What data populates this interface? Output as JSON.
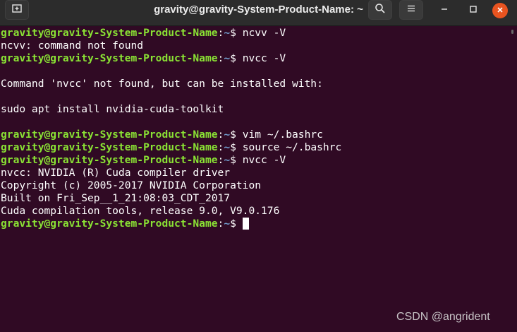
{
  "window": {
    "title": "gravity@gravity-System-Product-Name: ~"
  },
  "icons": {
    "new_tab": "new-tab-icon",
    "search": "search-icon",
    "menu": "hamburger-menu-icon",
    "minimize": "minimize-icon",
    "maximize": "maximize-icon",
    "close": "close-icon"
  },
  "colors": {
    "terminal_bg": "#300a24",
    "prompt_user": "#8ae234",
    "prompt_path": "#729fcf",
    "close_button": "#e95420"
  },
  "terminal": {
    "prompt_user": "gravity@gravity-System-Product-Name",
    "prompt_colon": ":",
    "prompt_path": "~",
    "prompt_symbol": "$ ",
    "lines": [
      {
        "type": "prompt",
        "command": "ncvv -V"
      },
      {
        "type": "output",
        "text": "ncvv: command not found"
      },
      {
        "type": "prompt",
        "command": "nvcc -V"
      },
      {
        "type": "output",
        "text": ""
      },
      {
        "type": "output",
        "text": "Command 'nvcc' not found, but can be installed with:"
      },
      {
        "type": "output",
        "text": ""
      },
      {
        "type": "output",
        "text": "sudo apt install nvidia-cuda-toolkit"
      },
      {
        "type": "output",
        "text": ""
      },
      {
        "type": "prompt",
        "command": "vim ~/.bashrc"
      },
      {
        "type": "prompt",
        "command": "source ~/.bashrc"
      },
      {
        "type": "prompt",
        "command": "nvcc -V"
      },
      {
        "type": "output",
        "text": "nvcc: NVIDIA (R) Cuda compiler driver"
      },
      {
        "type": "output",
        "text": "Copyright (c) 2005-2017 NVIDIA Corporation"
      },
      {
        "type": "output",
        "text": "Built on Fri_Sep__1_21:08:03_CDT_2017"
      },
      {
        "type": "output",
        "text": "Cuda compilation tools, release 9.0, V9.0.176"
      },
      {
        "type": "prompt_active",
        "command": ""
      }
    ]
  },
  "watermark": "CSDN @angrident"
}
